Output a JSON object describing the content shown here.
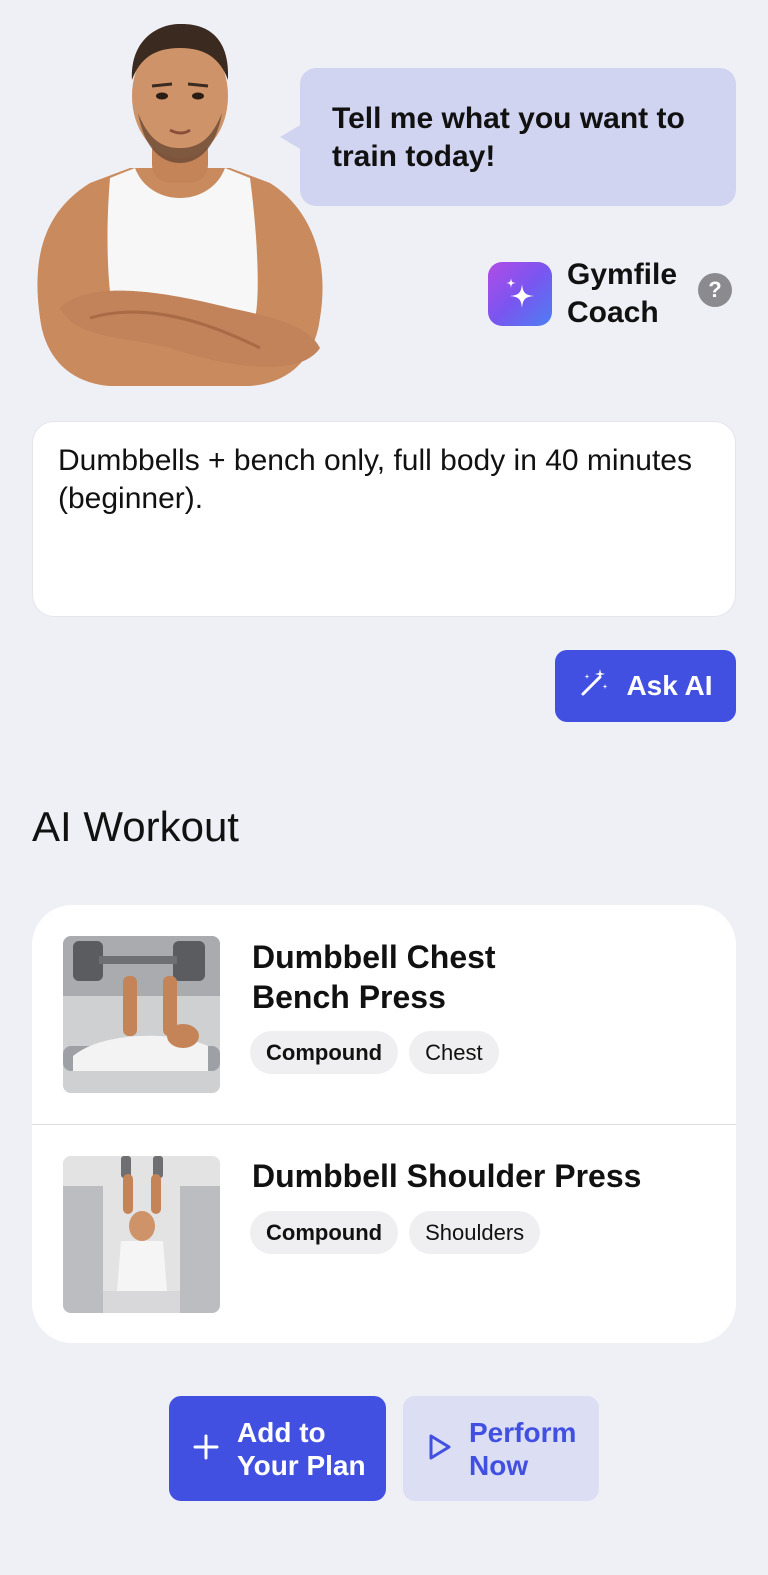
{
  "coach": {
    "bubble_text": "Tell me what you want to train today!",
    "name": "Gymfile Coach",
    "help_label": "?",
    "avatar_icon": "coach-avatar-illustration",
    "logo_icon": "sparkles-icon"
  },
  "prompt": {
    "value": "Dumbbells + bench only, full body in 40 minutes (beginner)."
  },
  "ask_button": {
    "label": "Ask AI",
    "icon": "magic-wand-icon"
  },
  "section": {
    "title": "AI Workout"
  },
  "exercises": [
    {
      "title": "Dumbbell Chest Bench Press",
      "tags": [
        "Compound",
        "Chest"
      ],
      "thumbnail_icon": "bench-press-photo"
    },
    {
      "title": "Dumbbell Shoulder Press",
      "tags": [
        "Compound",
        "Shoulders"
      ],
      "thumbnail_icon": "shoulder-press-photo"
    }
  ],
  "actions": {
    "add_label": "Add to Your Plan",
    "perform_label": "Perform Now"
  },
  "colors": {
    "accent": "#4150e0",
    "bubble": "#d1d4f0",
    "background": "#eff0f5"
  }
}
